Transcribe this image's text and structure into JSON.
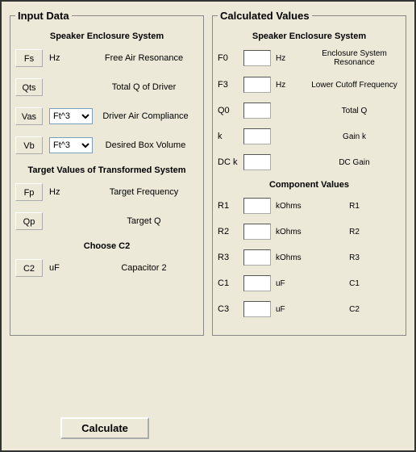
{
  "input": {
    "legend": "Input Data",
    "section1_heading": "Speaker Enclosure System",
    "rows1": [
      {
        "name": "Fs",
        "unit_type": "text",
        "unit": "Hz",
        "desc": "Free Air Resonance"
      },
      {
        "name": "Qts",
        "unit_type": "none",
        "unit": "",
        "desc": "Total Q of Driver"
      },
      {
        "name": "Vas",
        "unit_type": "select",
        "unit": "Ft^3",
        "desc": "Driver Air Compliance"
      },
      {
        "name": "Vb",
        "unit_type": "select",
        "unit": "Ft^3",
        "desc": "Desired Box Volume"
      }
    ],
    "section2_heading": "Target Values of Transformed System",
    "rows2": [
      {
        "name": "Fp",
        "unit_type": "text",
        "unit": "Hz",
        "desc": "Target Frequency"
      },
      {
        "name": "Qp",
        "unit_type": "none",
        "unit": "",
        "desc": "Target Q"
      }
    ],
    "section3_heading": "Choose C2",
    "rows3": [
      {
        "name": "C2",
        "unit_type": "text",
        "unit": "uF",
        "desc": "Capacitor 2"
      }
    ]
  },
  "output": {
    "legend": "Calculated Values",
    "section1_heading": "Speaker Enclosure System",
    "rows1": [
      {
        "name": "F0",
        "unit": "Hz",
        "desc": "Enclosure System Resonance"
      },
      {
        "name": "F3",
        "unit": "Hz",
        "desc": "Lower Cutoff Frequency"
      },
      {
        "name": "Q0",
        "unit": "",
        "desc": "Total Q"
      },
      {
        "name": "k",
        "unit": "",
        "desc": "Gain k"
      },
      {
        "name": "DC k",
        "unit": "",
        "desc": "DC Gain"
      }
    ],
    "section2_heading": "Component Values",
    "rows2": [
      {
        "name": "R1",
        "unit": "kOhms",
        "desc": "R1"
      },
      {
        "name": "R2",
        "unit": "kOhms",
        "desc": "R2"
      },
      {
        "name": "R3",
        "unit": "kOhms",
        "desc": "R3"
      },
      {
        "name": "C1",
        "unit": "uF",
        "desc": "C1"
      },
      {
        "name": "C3",
        "unit": "uF",
        "desc": "C2"
      }
    ]
  },
  "buttons": {
    "calculate": "Calculate"
  }
}
